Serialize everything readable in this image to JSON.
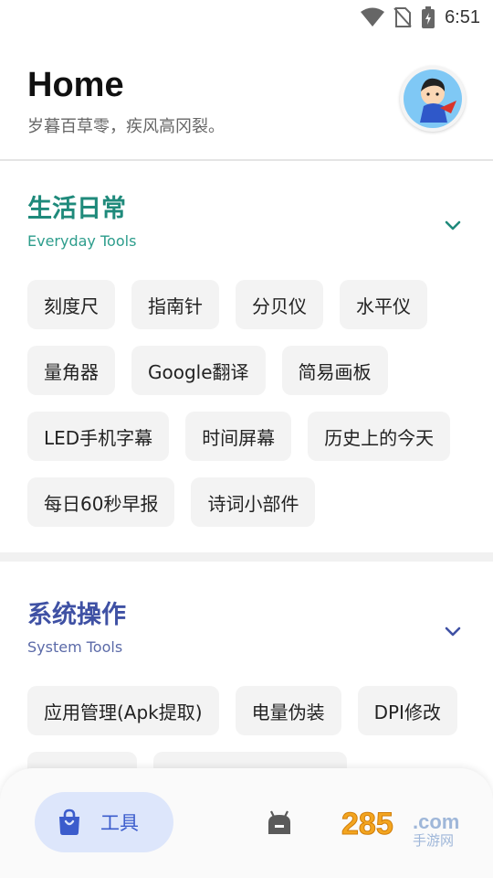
{
  "status_bar": {
    "time": "6:51",
    "icons": [
      "wifi-icon",
      "no-sim-icon",
      "battery-charging-icon"
    ]
  },
  "header": {
    "title": "Home",
    "subtitle": "岁暮百草零，疾风高冈裂。"
  },
  "sections": [
    {
      "title": "生活日常",
      "subtitle": "Everyday Tools",
      "color": "#1f8a7b",
      "items": [
        "刻度尺",
        "指南针",
        "分贝仪",
        "水平仪",
        "量角器",
        "Google翻译",
        "简易画板",
        "LED手机字幕",
        "时间屏幕",
        "历史上的今天",
        "每日60秒早报",
        "诗词小部件"
      ]
    },
    {
      "title": "系统操作",
      "subtitle": "System Tools",
      "color": "#3f51a4",
      "items": [
        "应用管理(Apk提取)",
        "电量伪装",
        "DPI修改"
      ]
    }
  ],
  "bottom_nav": {
    "active_label": "工具",
    "active_icon": "bag-icon",
    "second_icon": "android-robot-icon",
    "watermark_text": "285.com 手游网"
  },
  "colors": {
    "accent_teal": "#1f8a7b",
    "accent_indigo": "#3f51a4",
    "nav_active_bg": "#dde6fb"
  }
}
